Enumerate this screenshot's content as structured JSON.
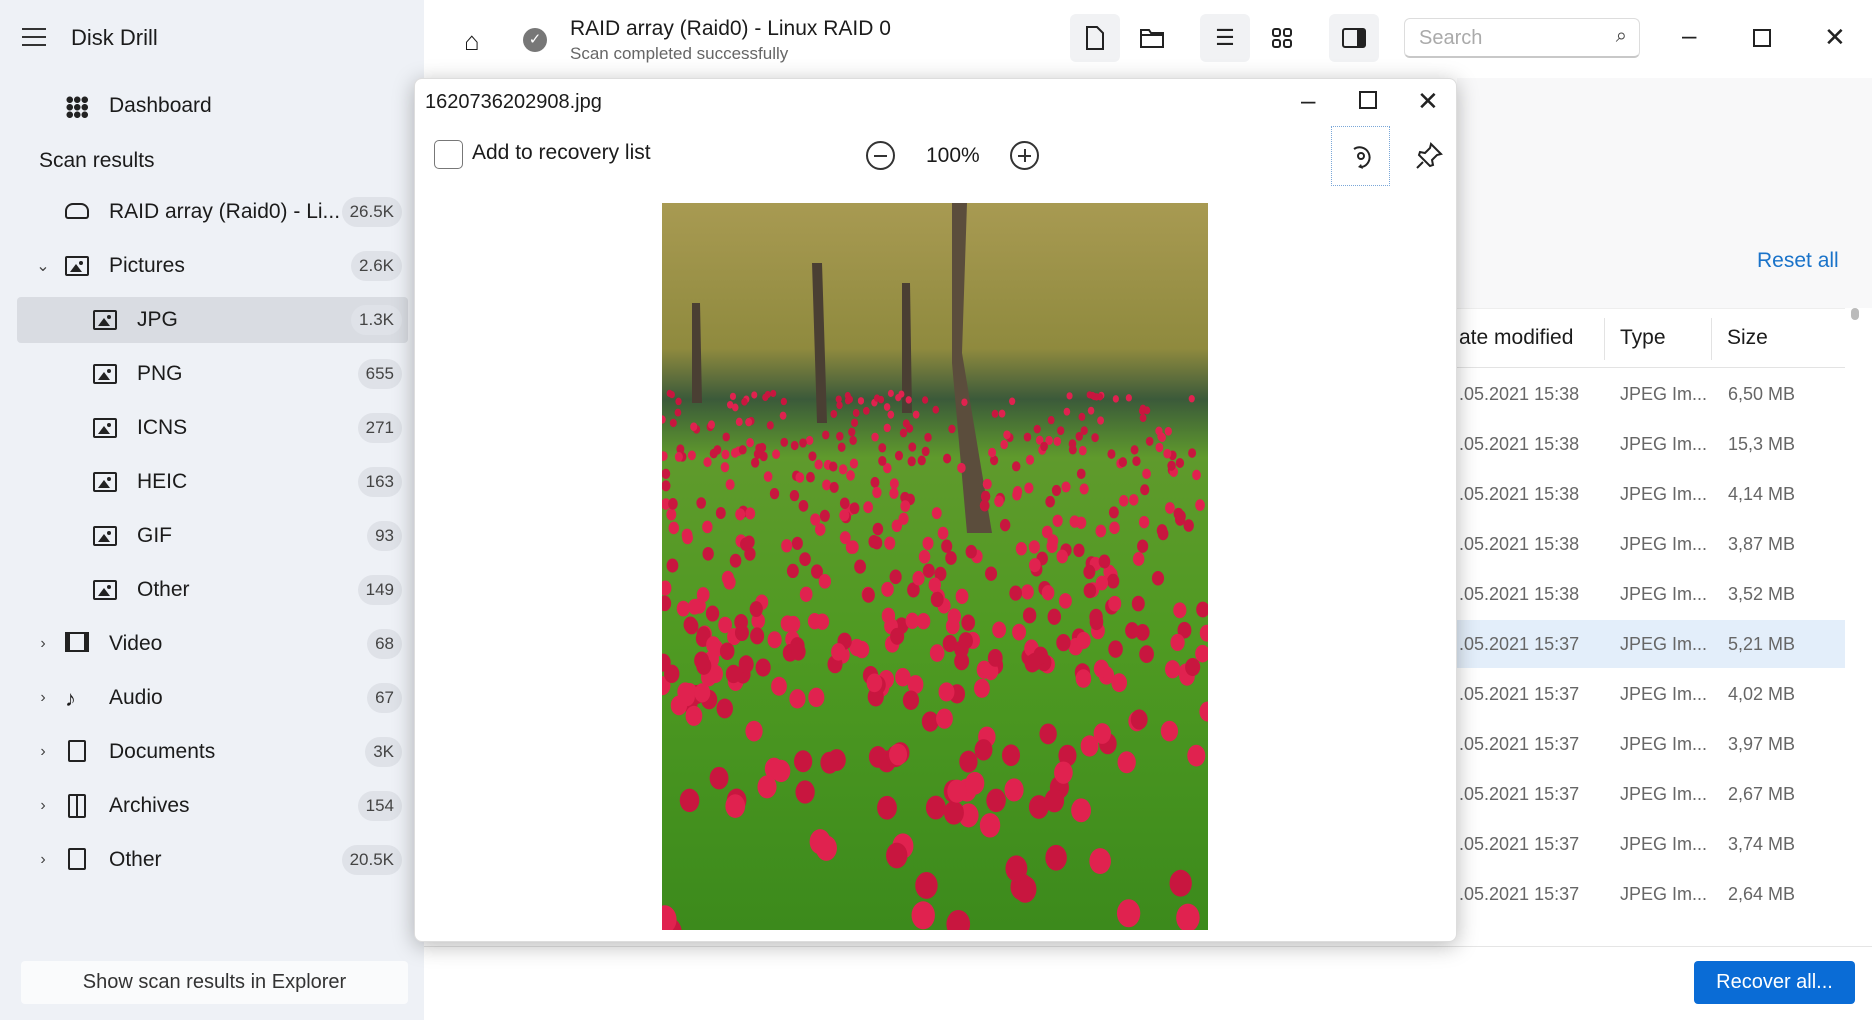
{
  "app": {
    "title": "Disk Drill"
  },
  "sidebar": {
    "dashboard": "Dashboard",
    "scan_results": "Scan results",
    "items": [
      {
        "label": "RAID array (Raid0) - Li...",
        "count": "26.5K",
        "icon": "drive-icon",
        "level": 0,
        "chevron": ""
      },
      {
        "label": "Pictures",
        "count": "2.6K",
        "icon": "image-icon",
        "level": 0,
        "chevron": "expanded"
      },
      {
        "label": "JPG",
        "count": "1.3K",
        "icon": "image-icon",
        "level": 1,
        "selected": true
      },
      {
        "label": "PNG",
        "count": "655",
        "icon": "image-icon",
        "level": 1
      },
      {
        "label": "ICNS",
        "count": "271",
        "icon": "image-icon",
        "level": 1
      },
      {
        "label": "HEIC",
        "count": "163",
        "icon": "image-icon",
        "level": 1
      },
      {
        "label": "GIF",
        "count": "93",
        "icon": "image-icon",
        "level": 1
      },
      {
        "label": "Other",
        "count": "149",
        "icon": "image-icon",
        "level": 1
      },
      {
        "label": "Video",
        "count": "68",
        "icon": "film-icon",
        "level": 0,
        "chevron": "collapsed"
      },
      {
        "label": "Audio",
        "count": "67",
        "icon": "music-note-icon",
        "level": 0,
        "chevron": "collapsed"
      },
      {
        "label": "Documents",
        "count": "3K",
        "icon": "document-icon",
        "level": 0,
        "chevron": "collapsed"
      },
      {
        "label": "Archives",
        "count": "154",
        "icon": "archive-icon",
        "level": 0,
        "chevron": "collapsed"
      },
      {
        "label": "Other",
        "count": "20.5K",
        "icon": "file-icon",
        "level": 0,
        "chevron": "collapsed"
      }
    ],
    "show_in_explorer": "Show scan results in Explorer"
  },
  "header": {
    "title": "RAID array (Raid0) - Linux RAID 0",
    "subtitle": "Scan completed successfully",
    "search_placeholder": "Search"
  },
  "preview": {
    "filename": "1620736202908.jpg",
    "add_to_recovery": "Add to recovery list",
    "checked": false,
    "zoom": "100%"
  },
  "filters": {
    "reset_all": "Reset all"
  },
  "table": {
    "columns": [
      "ate modified",
      "Type",
      "Size"
    ],
    "rows": [
      [
        ".05.2021 15:38",
        "JPEG Im...",
        "6,50 MB"
      ],
      [
        ".05.2021 15:38",
        "JPEG Im...",
        "15,3 MB"
      ],
      [
        ".05.2021 15:38",
        "JPEG Im...",
        "4,14 MB"
      ],
      [
        ".05.2021 15:38",
        "JPEG Im...",
        "3,87 MB"
      ],
      [
        ".05.2021 15:38",
        "JPEG Im...",
        "3,52 MB"
      ],
      [
        ".05.2021 15:37",
        "JPEG Im...",
        "5,21 MB"
      ],
      [
        ".05.2021 15:37",
        "JPEG Im...",
        "4,02 MB"
      ],
      [
        ".05.2021 15:37",
        "JPEG Im...",
        "3,97 MB"
      ],
      [
        ".05.2021 15:37",
        "JPEG Im...",
        "2,67 MB"
      ],
      [
        ".05.2021 15:37",
        "JPEG Im...",
        "3,74 MB"
      ],
      [
        ".05.2021 15:37",
        "JPEG Im...",
        "2,64 MB"
      ]
    ],
    "selected_row": 5
  },
  "footer": {
    "recover_all": "Recover all..."
  },
  "colors": {
    "accent": "#0a6cd6",
    "link": "#1a73c9",
    "selected_row": "#e3eefa",
    "sidebar_bg": "#eef1f6"
  }
}
